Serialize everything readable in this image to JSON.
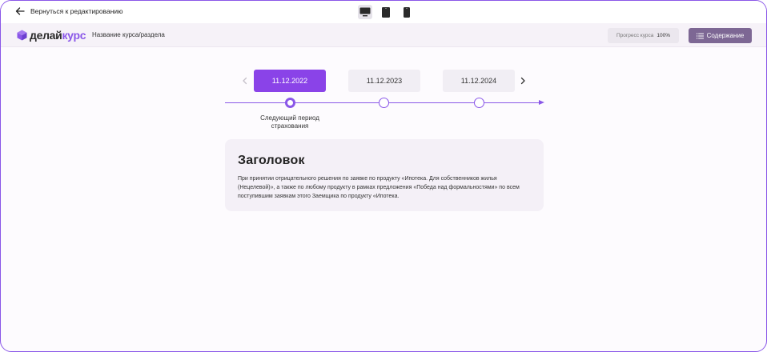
{
  "topbar": {
    "back_label": "Вернуться к редактированию",
    "devices": [
      {
        "name": "desktop",
        "icon": "desktop-icon",
        "active": true
      },
      {
        "name": "tablet",
        "icon": "tablet-icon",
        "active": false
      },
      {
        "name": "phone",
        "icon": "phone-icon",
        "active": false
      }
    ]
  },
  "header": {
    "logo_part1": "делай",
    "logo_part2": "курс",
    "course_title": "Название курса/раздела",
    "progress_label": "Прогресс курса",
    "progress_value": "100%",
    "contents_label": "Содержание"
  },
  "timeline": {
    "dates": [
      "11.12.2022",
      "11.12.2023",
      "11.12.2024"
    ],
    "active_index": 0,
    "period_label": "Следующий период страхования"
  },
  "card": {
    "title": "Заголовок",
    "text": "При принятии отрицательного решения по заявке по продукту «Ипотека. Для собственников жилья (Нецелевой)», а также по любому продукту в рамках предложения «Победа над формальностями» по всем поступившим заявкам этого Заемщика по продукту «Ипотека."
  },
  "colors": {
    "accent": "#8a57e8",
    "active_date": "#8a43e8",
    "contents_button": "#7d6794",
    "header_bg": "#f6f2f8",
    "card_bg": "#f4f0f7"
  }
}
